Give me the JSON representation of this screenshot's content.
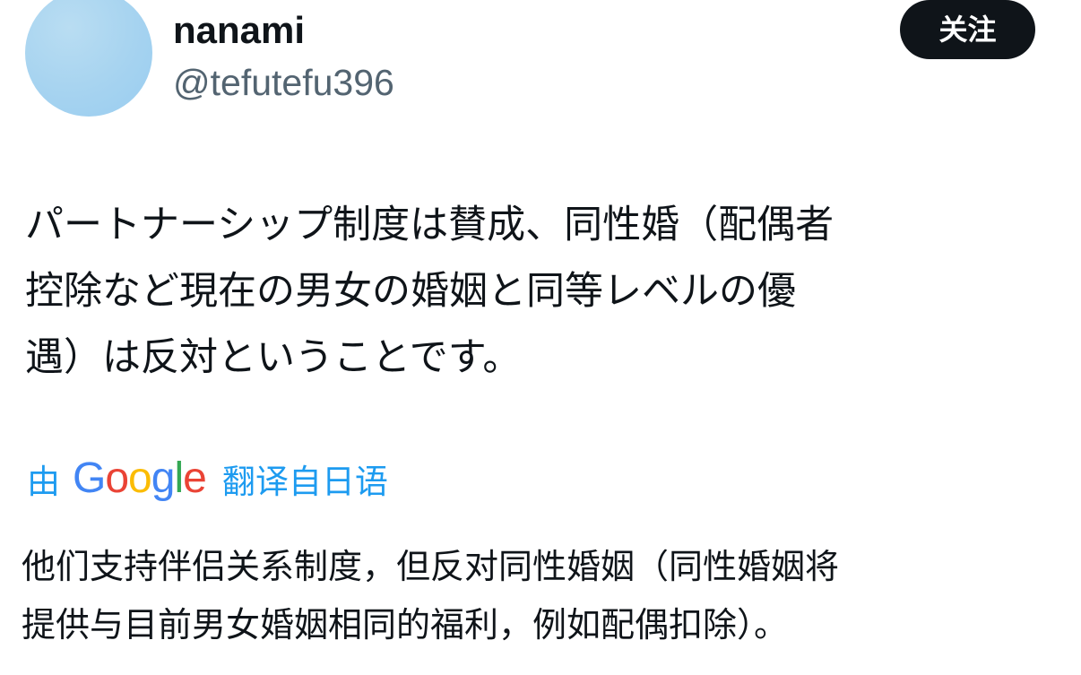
{
  "user": {
    "display_name": "nanami",
    "handle": "@tefutefu396",
    "avatar_color": "#a6d3f0"
  },
  "follow_button": {
    "label": "关注"
  },
  "tweet": {
    "text": "パートナーシップ制度は賛成、同性婚（配偶者\n控除など現在の男女の婚姻と同等レベルの優\n遇）は反対ということです。"
  },
  "translation": {
    "prefix": "由",
    "provider": "Google",
    "suffix": "翻译自日语",
    "link_color": "#1d9bf0",
    "text": "他们支持伴侣关系制度，但反对同性婚姻（同性婚姻将\n提供与目前男女婚姻相同的福利，例如配偶扣除）。"
  }
}
